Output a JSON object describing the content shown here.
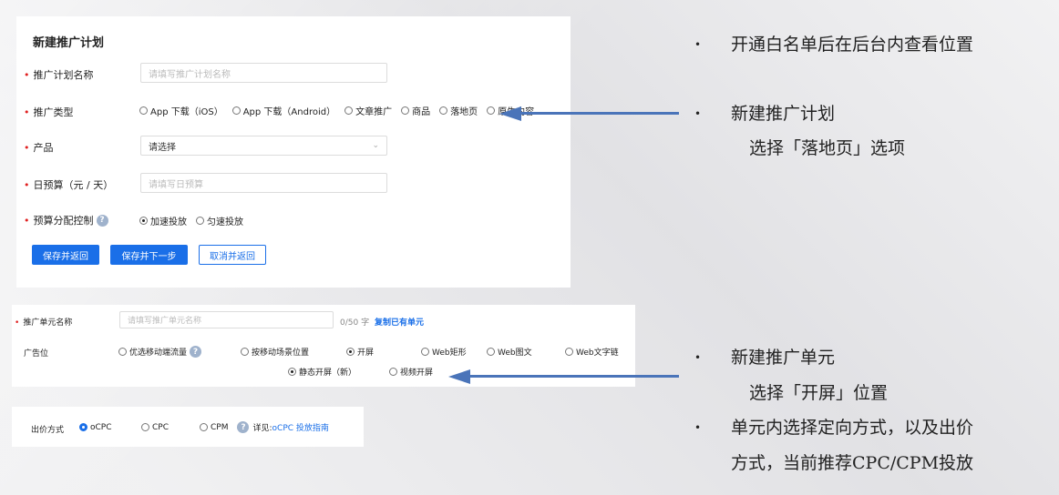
{
  "form": {
    "title": "新建推广计划",
    "plan_name_label": "推广计划名称",
    "plan_name_placeholder": "请填写推广计划名称",
    "type_label": "推广类型",
    "type_options": [
      "App 下载（iOS）",
      "App 下载（Android）",
      "文章推广",
      "商品",
      "落地页",
      "原生内容"
    ],
    "product_label": "产品",
    "product_value": "请选择",
    "budget_label": "日预算（元 / 天）",
    "budget_placeholder": "请填写日预算",
    "alloc_label": "预算分配控制",
    "alloc_options": [
      "加速投放",
      "匀速投放"
    ],
    "btn_save_back": "保存并返回",
    "btn_save_next": "保存并下一步",
    "btn_cancel_back": "取消并返回"
  },
  "unit": {
    "name_label": "推广单元名称",
    "name_placeholder": "请填写推广单元名称",
    "count": "0/50 字",
    "copy_link": "复制已有单元",
    "ad_pos_label": "广告位",
    "pos_options": [
      "优选移动端流量",
      "按移动场景位置",
      "开屏",
      "Web矩形",
      "Web图文",
      "Web文字链"
    ],
    "sub_options": [
      "静态开屏（新）",
      "视频开屏"
    ]
  },
  "bid": {
    "label": "出价方式",
    "options": [
      "oCPC",
      "CPC",
      "CPM"
    ],
    "guide_prefix": "详见:",
    "guide_link": "oCPC 投放指南"
  },
  "notes": {
    "n1": "开通白名单后在后台内查看位置",
    "n2_line1": "新建推广计划",
    "n2_line2": "选择「落地页」选项",
    "n3_line1": "新建推广单元",
    "n3_line2": "选择「开屏」位置",
    "n4_line1": "单元内选择定向方式，以及出价",
    "n4_line2": "方式，当前推荐CPC/CPM投放"
  },
  "colors": {
    "primary": "#1a6fe8",
    "arrow": "#4a74b9",
    "required": "#e02020"
  },
  "icons": {
    "help": "question-circle-icon",
    "dropdown": "chevron-down-icon"
  }
}
